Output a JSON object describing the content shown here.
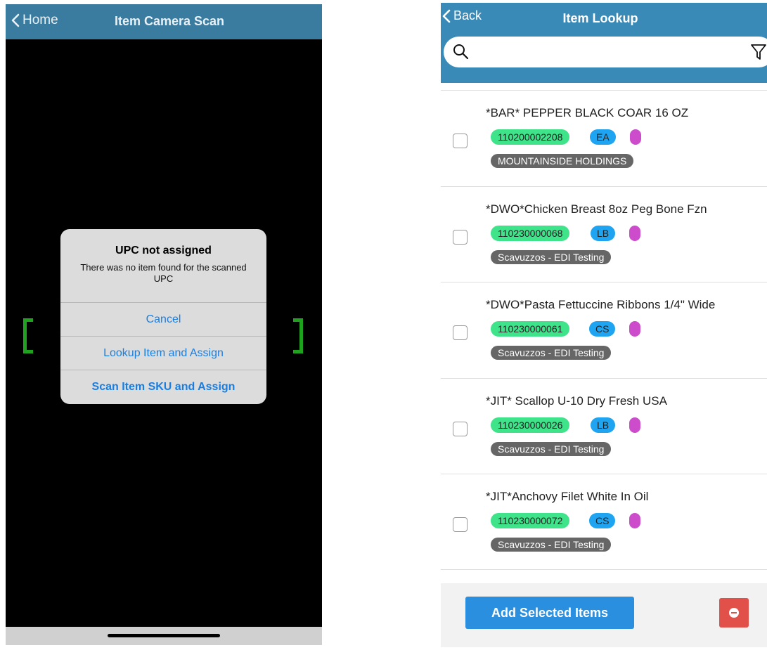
{
  "left": {
    "nav": {
      "back_label": "Home",
      "title": "Item Camera Scan"
    },
    "alert": {
      "title": "UPC not assigned",
      "message": "There was no item found for the scanned UPC",
      "buttons": [
        "Cancel",
        "Lookup Item and Assign",
        "Scan Item SKU and Assign"
      ]
    }
  },
  "right": {
    "nav": {
      "back_label": "Back",
      "title": "Item Lookup"
    },
    "search": {
      "placeholder": ""
    },
    "items": [
      {
        "name": "*BAR* PEPPER  BLACK COAR 16 OZ",
        "sku": "110200002208",
        "uom": "EA",
        "vendor": "MOUNTAINSIDE HOLDINGS"
      },
      {
        "name": "*DWO*Chicken Breast 8oz Peg Bone Fzn",
        "sku": "110230000068",
        "uom": "LB",
        "vendor": "Scavuzzos - EDI Testing"
      },
      {
        "name": "*DWO*Pasta Fettuccine Ribbons 1/4\" Wide",
        "sku": "110230000061",
        "uom": "CS",
        "vendor": "Scavuzzos - EDI Testing"
      },
      {
        "name": "*JIT* Scallop U-10 Dry Fresh USA",
        "sku": "110230000026",
        "uom": "LB",
        "vendor": "Scavuzzos - EDI Testing"
      },
      {
        "name": "*JIT*Anchovy Filet White In Oil",
        "sku": "110230000072",
        "uom": "CS",
        "vendor": "Scavuzzos - EDI Testing"
      }
    ],
    "footer": {
      "add_label": "Add Selected Items"
    }
  },
  "colors": {
    "nav_left": "#3a7ba0",
    "nav_right": "#3a8ab8",
    "sku_badge": "#3ee38a",
    "uom_badge": "#1ea4f0",
    "dot": "#cc4ccc",
    "vendor_badge": "#666666",
    "primary_button": "#2b8fe0",
    "danger_button": "#e2504a",
    "scan_bracket": "#1fa31f"
  },
  "icons": [
    "chevron-left-icon",
    "search-icon",
    "filter-icon",
    "minus-circle-icon"
  ]
}
